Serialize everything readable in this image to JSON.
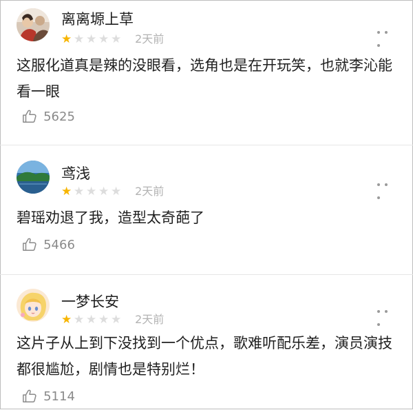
{
  "comments": [
    {
      "username": "离离塬上草",
      "rating": 1,
      "time": "2天前",
      "content": "这服化道真是辣的没眼看，选角也是在开玩笑，也就李沁能看一眼",
      "likes": "5625",
      "avatar_icon": "avatar-photo-icon"
    },
    {
      "username": "鸢浅",
      "rating": 1,
      "time": "2天前",
      "content": "碧瑶劝退了我，造型太奇葩了",
      "likes": "5466",
      "avatar_icon": "avatar-landscape-icon"
    },
    {
      "username": "一梦长安",
      "rating": 1,
      "time": "2天前",
      "content": "这片子从上到下没找到一个优点，歌难听配乐差，演员演技都很尴尬，剧情也是特别烂！",
      "likes": "5114",
      "avatar_icon": "avatar-anime-icon"
    }
  ],
  "colors": {
    "star_on": "#f7b500",
    "star_off": "#dddddd",
    "meta_text": "#b3b3b3"
  }
}
